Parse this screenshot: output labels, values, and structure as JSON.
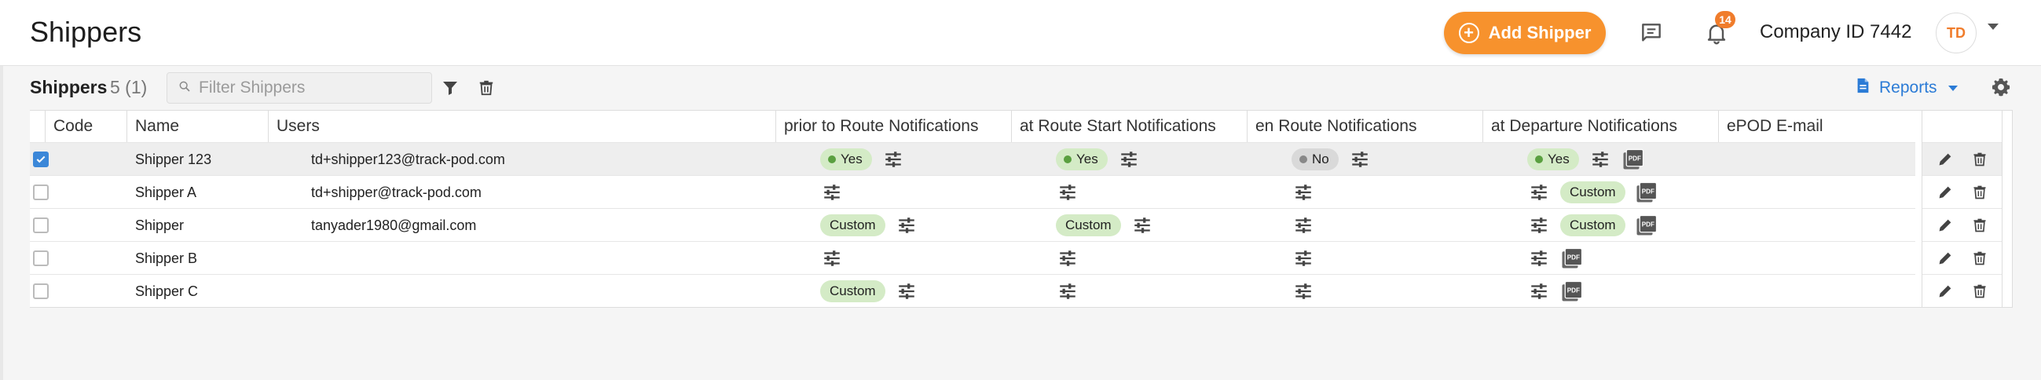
{
  "header": {
    "title": "Shippers",
    "add_button": "Add Shipper",
    "notifications_count": "14",
    "company": "Company ID 7442",
    "avatar_initials": "TD"
  },
  "toolbar": {
    "title": "Shippers",
    "count": "5 (1)",
    "filter_placeholder": "Filter Shippers",
    "reports_label": "Reports"
  },
  "table": {
    "columns": [
      "Code",
      "Name",
      "Users",
      "prior to Route Notifications",
      "at Route Start Notifications",
      "en Route Notifications",
      "at Departure Notifications",
      "ePOD E-mail"
    ],
    "rows": [
      {
        "checked": true,
        "name": "Shipper 123",
        "users": "td+shipper123@track-pod.com",
        "prior": "Yes",
        "start": "Yes",
        "enroute": "No",
        "departure": "Yes",
        "departure_pdf": true
      },
      {
        "checked": false,
        "name": "Shipper A",
        "users": "td+shipper@track-pod.com",
        "prior": "",
        "start": "",
        "enroute": "",
        "departure": "Custom",
        "departure_pdf": true
      },
      {
        "checked": false,
        "name": "Shipper",
        "users": "tanyader1980@gmail.com",
        "prior": "Custom",
        "start": "Custom",
        "enroute": "",
        "departure": "Custom",
        "departure_pdf": true
      },
      {
        "checked": false,
        "name": "Shipper B",
        "users": "",
        "prior": "",
        "start": "",
        "enroute": "",
        "departure": "",
        "departure_pdf": true
      },
      {
        "checked": false,
        "name": "Shipper C",
        "users": "",
        "prior": "Custom",
        "start": "",
        "enroute": "",
        "departure": "",
        "departure_pdf": true
      }
    ]
  },
  "colors": {
    "accent": "#f7922d",
    "link": "#2b7bd6",
    "pill_green": "#d4ebc6",
    "pill_grey": "#d9d9d9",
    "checkbox": "#3b87d8"
  },
  "icons": {
    "chat": "chat-icon",
    "bell": "bell-icon",
    "filter": "filter-icon",
    "trash": "trash-icon",
    "reports": "document-icon",
    "settings": "gear-icon",
    "tune": "sliders-icon",
    "pdf": "pdf-icon",
    "edit": "pencil-icon",
    "search": "search-icon"
  }
}
